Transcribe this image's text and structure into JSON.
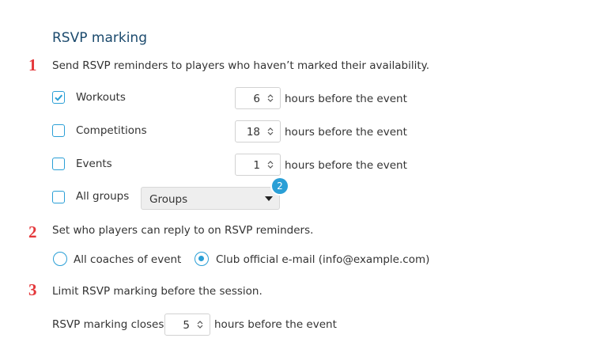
{
  "section": {
    "title": "RSVP marking"
  },
  "step1": {
    "number": "1",
    "description": "Send RSVP reminders to players who haven’t marked their availability.",
    "rows": [
      {
        "label": "Workouts",
        "checked": true,
        "hours": "6",
        "suffix": "hours before the event"
      },
      {
        "label": "Competitions",
        "checked": false,
        "hours": "18",
        "suffix": "hours before the event"
      },
      {
        "label": "Events",
        "checked": false,
        "hours": "1",
        "suffix": "hours before the event"
      }
    ],
    "all_groups": {
      "label": "All groups",
      "checked": false,
      "select_value": "Groups",
      "badge": "2"
    }
  },
  "step2": {
    "number": "2",
    "description": "Set who players can reply to on RSVP reminders.",
    "options": [
      {
        "label": "All coaches of event",
        "selected": false
      },
      {
        "label": "Club official e-mail (info@example.com)",
        "selected": true
      }
    ]
  },
  "step3": {
    "number": "3",
    "description": "Limit RSVP marking before the session.",
    "closes_label": "RSVP marking closes:",
    "closes_hours": "5",
    "closes_suffix": "hours before the event"
  },
  "colors": {
    "accent": "#2a9fd6",
    "step_number": "#e4383b",
    "title": "#1b4a6d"
  },
  "icons": {
    "checkmark": "checkmark-icon",
    "spinner": "spinner-arrows-icon",
    "dropdown": "caret-down-icon"
  }
}
